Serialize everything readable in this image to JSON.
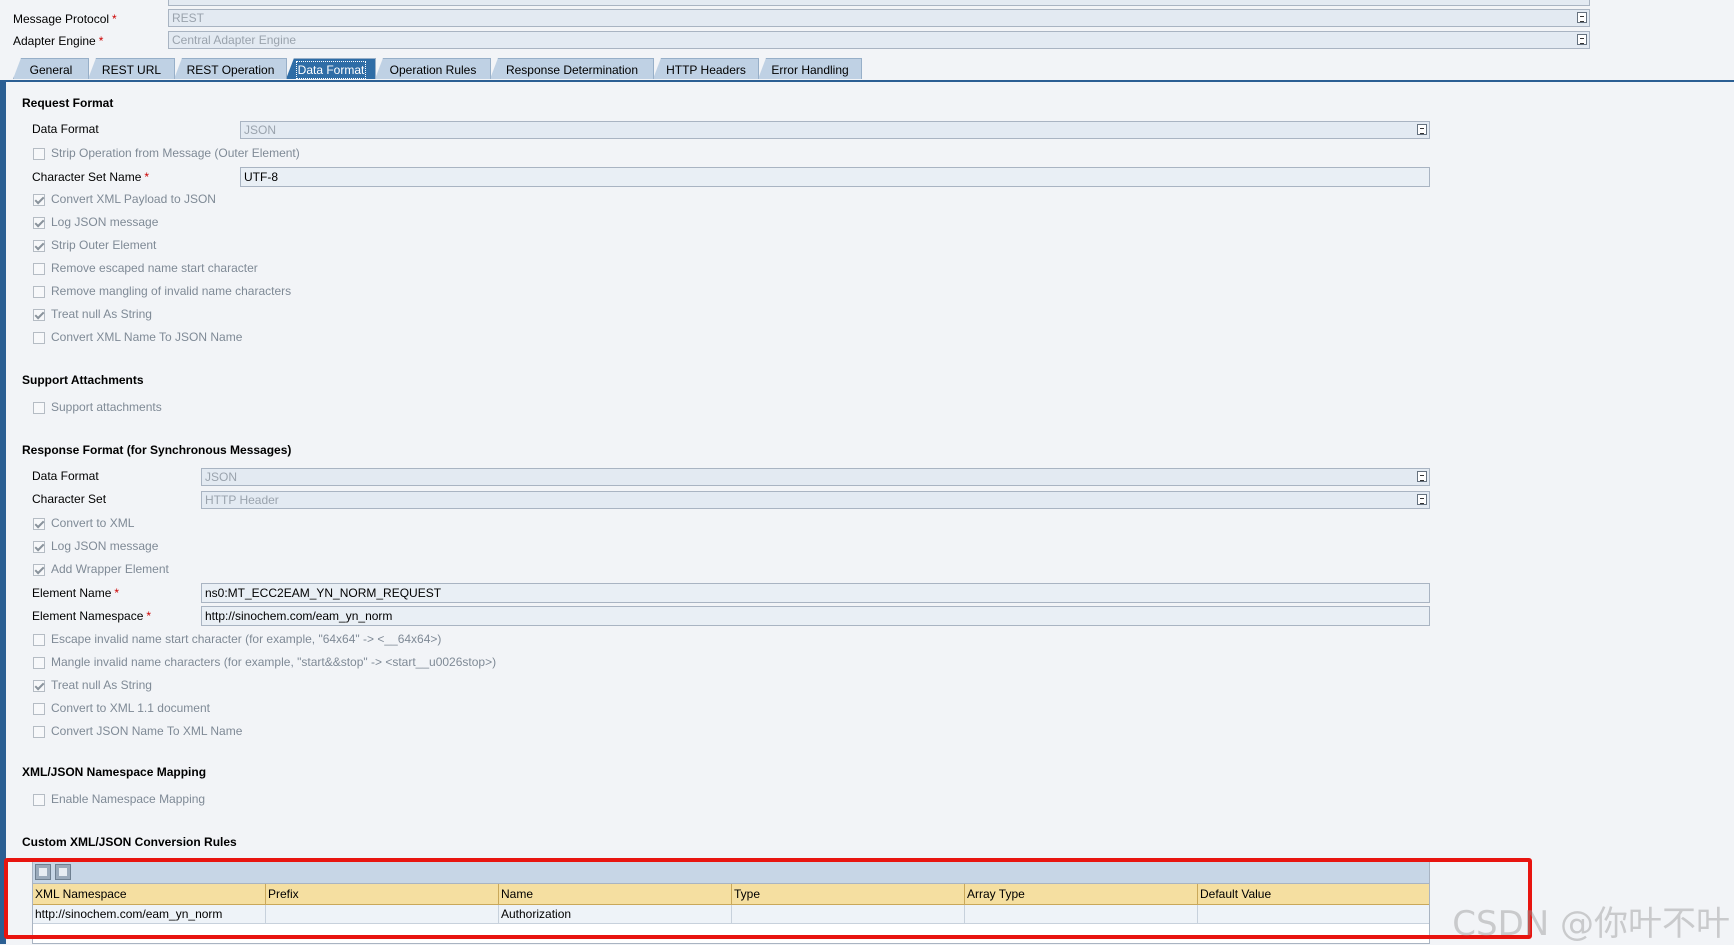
{
  "top": {
    "message_protocol_label": "Message Protocol",
    "message_protocol_value": "REST",
    "adapter_engine_label": "Adapter Engine",
    "adapter_engine_value": "Central Adapter Engine"
  },
  "tabs": [
    "General",
    "REST URL",
    "REST Operation",
    "Data Format",
    "Operation Rules",
    "Response Determination",
    "HTTP Headers",
    "Error Handling"
  ],
  "active_tab": "Data Format",
  "request": {
    "title": "Request Format",
    "data_format_label": "Data Format",
    "data_format_value": "JSON",
    "strip_operation": "Strip Operation from Message (Outer Element)",
    "charset_label": "Character Set Name",
    "charset_value": "UTF-8",
    "checkboxes": [
      {
        "label": "Convert XML Payload to JSON",
        "checked": true
      },
      {
        "label": "Log JSON message",
        "checked": true
      },
      {
        "label": "Strip Outer Element",
        "checked": true
      },
      {
        "label": "Remove escaped name start character",
        "checked": false
      },
      {
        "label": "Remove mangling of invalid name characters",
        "checked": false
      },
      {
        "label": "Treat null As String",
        "checked": true
      },
      {
        "label": "Convert XML Name To JSON Name",
        "checked": false
      }
    ]
  },
  "attachments": {
    "title": "Support Attachments",
    "support_label": "Support attachments"
  },
  "response": {
    "title": "Response Format (for Synchronous Messages)",
    "data_format_label": "Data Format",
    "data_format_value": "JSON",
    "charset_label": "Character Set",
    "charset_value": "HTTP Header",
    "checkboxes_top": [
      {
        "label": "Convert to XML",
        "checked": true
      },
      {
        "label": "Log JSON message",
        "checked": true
      },
      {
        "label": "Add Wrapper Element",
        "checked": true
      }
    ],
    "element_name_label": "Element Name",
    "element_name_value": "ns0:MT_ECC2EAM_YN_NORM_REQUEST",
    "element_namespace_label": "Element Namespace",
    "element_namespace_value": "http://sinochem.com/eam_yn_norm",
    "checkboxes_bottom": [
      {
        "label": "Escape invalid name start character (for example, \"64x64\" -> <__64x64>)",
        "checked": false
      },
      {
        "label": "Mangle invalid name characters (for example, \"start&&stop\" -> <start__u0026stop>)",
        "checked": false
      },
      {
        "label": "Treat null As String",
        "checked": true
      },
      {
        "label": "Convert to XML 1.1 document",
        "checked": false
      },
      {
        "label": "Convert JSON Name To XML Name",
        "checked": false
      }
    ]
  },
  "namespace_mapping": {
    "title": "XML/JSON Namespace Mapping",
    "enable_label": "Enable Namespace Mapping"
  },
  "custom_rules": {
    "title": "Custom XML/JSON Conversion Rules",
    "columns": [
      "XML Namespace",
      "Prefix",
      "Name",
      "Type",
      "Array Type",
      "Default Value"
    ],
    "rows": [
      [
        "http://sinochem.com/eam_yn_norm",
        "",
        "Authorization",
        "",
        "",
        ""
      ]
    ]
  },
  "watermark": "CSDN @你叶不叶",
  "colors": {
    "highlight": "#e8140f",
    "tab_active": "#2f6da6",
    "tab": "#bfd1e4"
  }
}
